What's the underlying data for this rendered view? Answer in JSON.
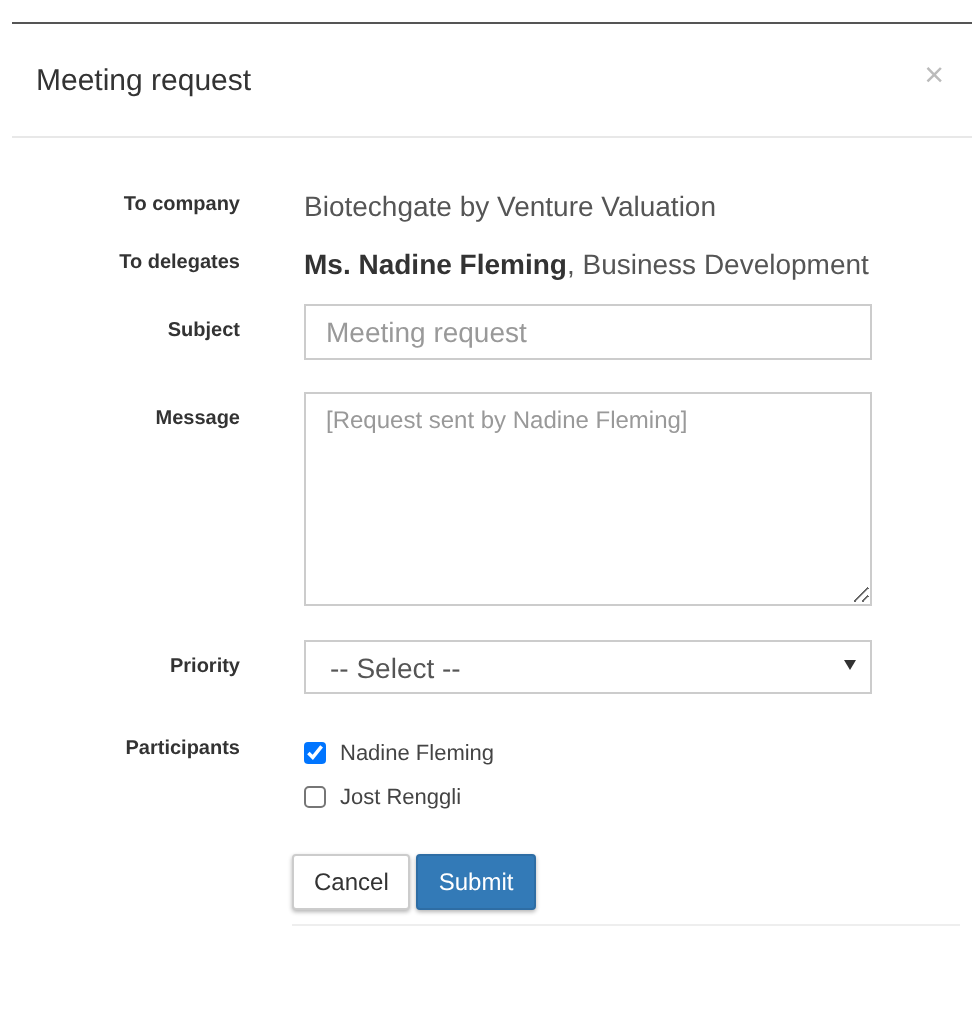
{
  "dialog": {
    "title": "Meeting request",
    "close": "×"
  },
  "fields": [
    {
      "kind": "static",
      "label": "To company",
      "value": "Biotechgate by Venture Valuation"
    },
    {
      "kind": "static",
      "label": "To delegates",
      "value": "**Ms. Nadine Fleming**, Business Development"
    },
    {
      "kind": "input",
      "label": "Subject",
      "placeholder": "Meeting request"
    },
    {
      "kind": "textarea",
      "label": "Message",
      "placeholder": "[Request sent by Nadine Fleming]"
    },
    {
      "kind": "select",
      "label": "Priority",
      "value": "-- Select --"
    },
    {
      "kind": "checkboxes",
      "label": "Participants",
      "options": [
        {
          "label": "Nadine Fleming",
          "checked": true
        },
        {
          "label": "Jost Renggli",
          "checked": false
        }
      ]
    }
  ],
  "buttons": [
    {
      "kind": "default",
      "label": "Cancel"
    },
    {
      "kind": "primary",
      "label": "Submit"
    }
  ]
}
